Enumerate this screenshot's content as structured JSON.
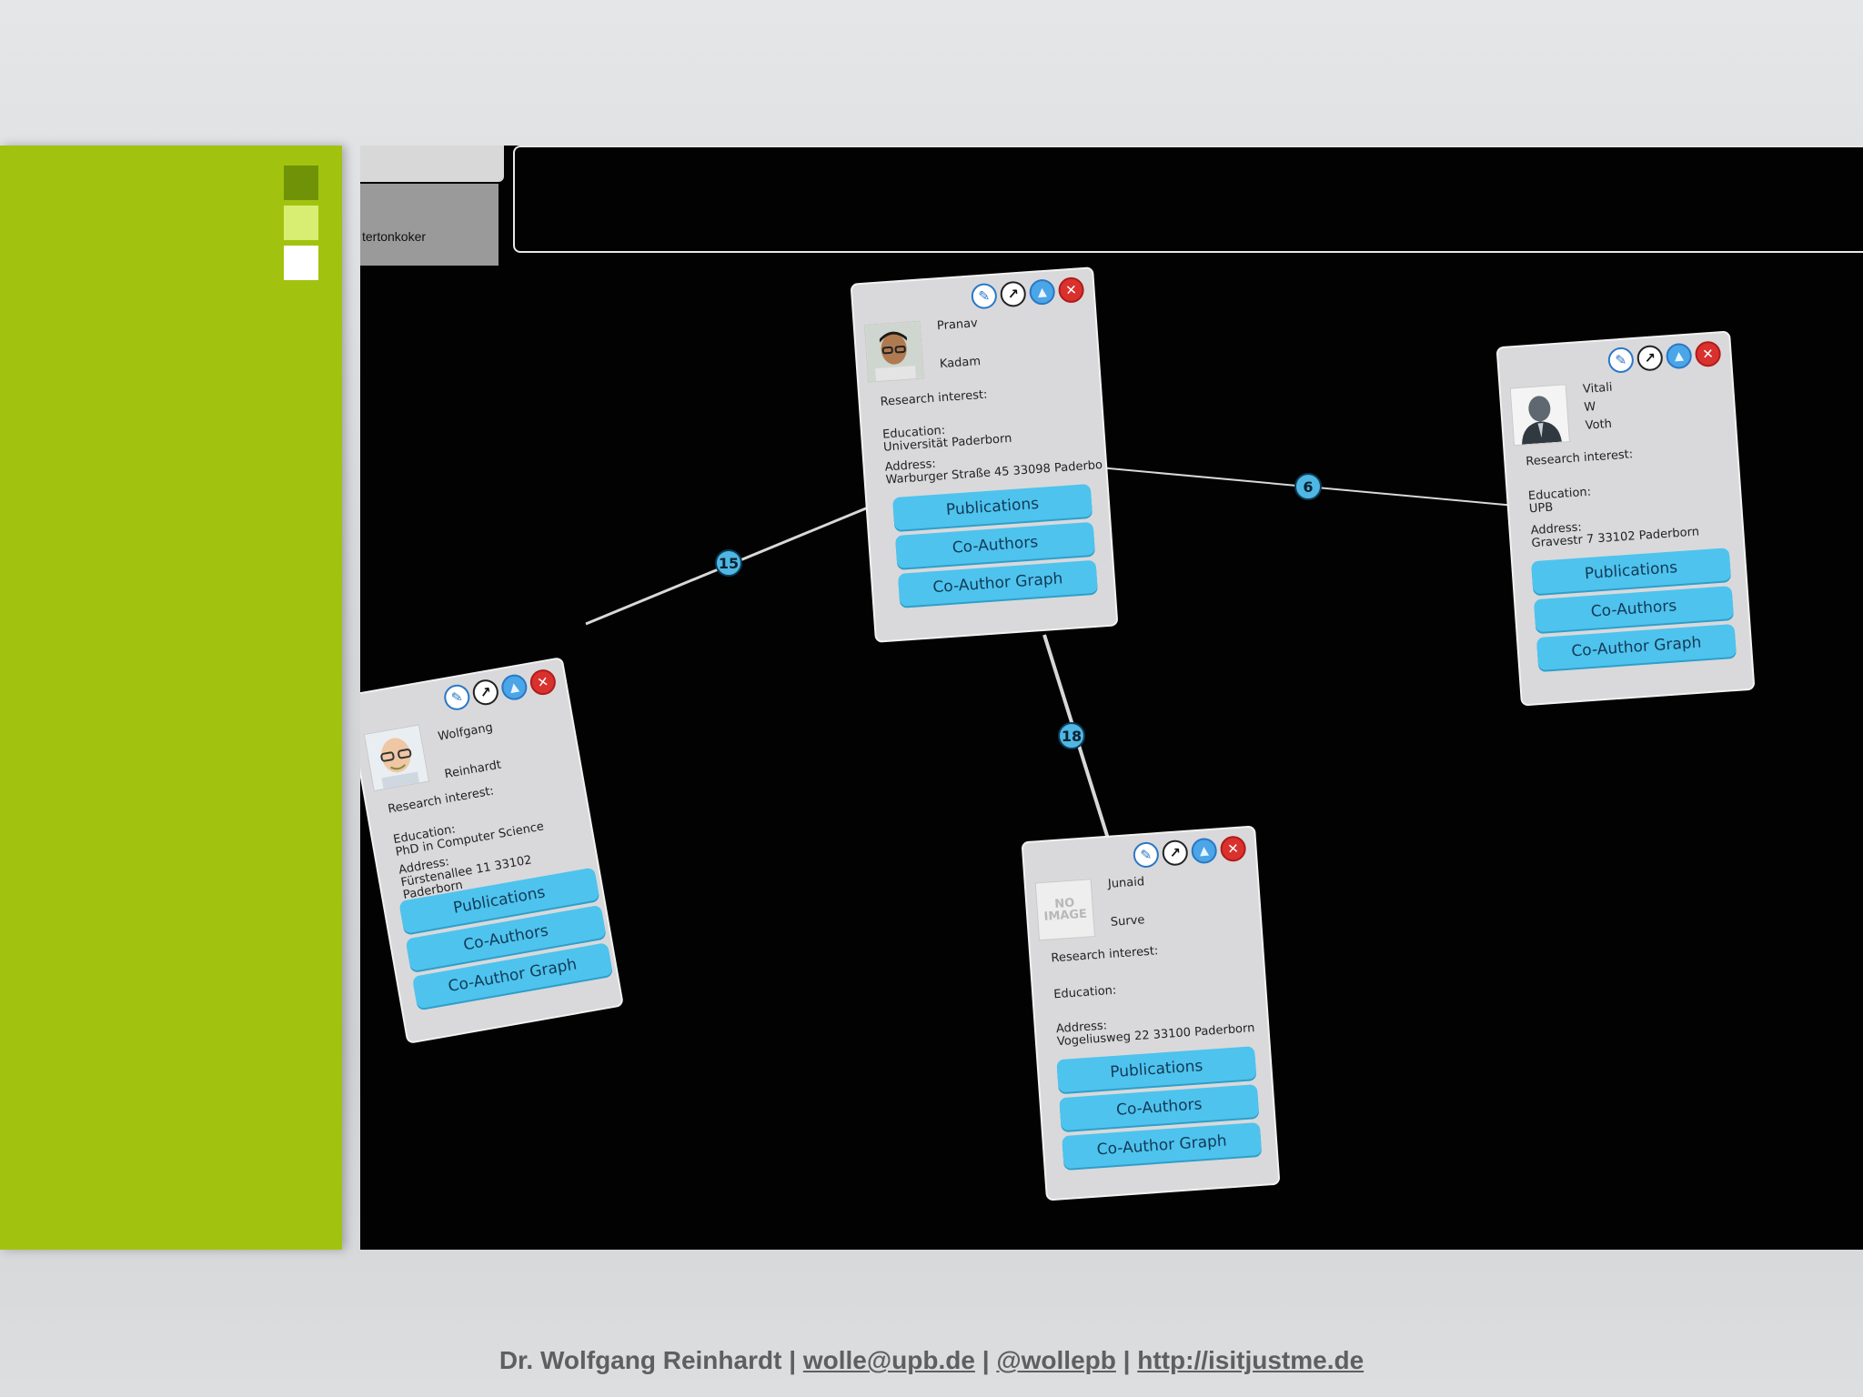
{
  "user_panel": {
    "name": "tertonkoker"
  },
  "swatches": [
    "#6f9207",
    "#d7ee72",
    "#ffffff"
  ],
  "colors": {
    "side_panel": "#a1c30f",
    "card_button": "#4ec3ee",
    "badge": "#4fb7e3",
    "close": "#d9312e"
  },
  "cards": [
    {
      "first": "Wolfgang",
      "middle": "",
      "last": "Reinhardt",
      "research_label": "Research interest:",
      "education_label": "Education:",
      "education_value": "PhD in Computer Science",
      "address_label": "Address:",
      "address_value": "Fürstenallee 11 33102 Paderborn",
      "avatar": "cartoon-bald-man-with-glasses"
    },
    {
      "first": "Pranav",
      "middle": "",
      "last": "Kadam",
      "research_label": "Research interest:",
      "education_label": "Education:",
      "education_value": "Universität Paderborn",
      "address_label": "Address:",
      "address_value": "Warburger Straße 45 33098 Paderbo",
      "avatar": "man-with-glasses-photo"
    },
    {
      "first": "Vitali",
      "middle": "W",
      "last": "Voth",
      "research_label": "Research interest:",
      "education_label": "Education:",
      "education_value": "UPB",
      "address_label": "Address:",
      "address_value": "Gravestr 7 33102 Paderborn",
      "avatar": "businessman-silhouette"
    },
    {
      "first": "Junaid",
      "middle": "",
      "last": "Surve",
      "research_label": "Research interest:",
      "education_label": "Education:",
      "education_value": "",
      "address_label": "Address:",
      "address_value": "Vogeliusweg 22 33100 Paderborn",
      "avatar": "no-image-placeholder"
    }
  ],
  "card_buttons": {
    "publications": "Publications",
    "coauthors": "Co-Authors",
    "coauthor_graph": "Co-Author Graph"
  },
  "no_image_text": {
    "line1": "NO",
    "line2": "IMAGE"
  },
  "edges": [
    {
      "from": "Wolfgang",
      "to": "Pranav",
      "label": "15"
    },
    {
      "from": "Pranav",
      "to": "Vitali",
      "label": "6"
    },
    {
      "from": "Pranav",
      "to": "Junaid",
      "label": "18"
    }
  ],
  "footer": {
    "author": "Dr. Wolfgang Reinhardt",
    "sep": "|",
    "email": "wolle@upb.de",
    "twitter": "@wollepb",
    "website": "http://isitjustme.de"
  }
}
